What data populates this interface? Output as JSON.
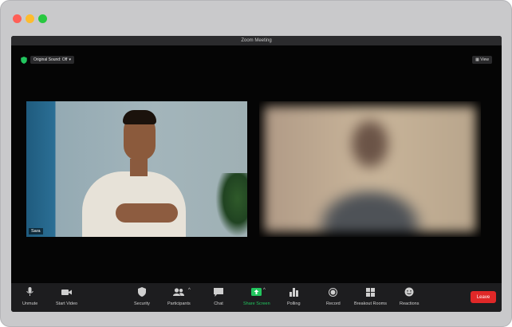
{
  "window": {
    "title": "Zoom Meeting"
  },
  "top_controls": {
    "sound_label": "Original Sound: Off",
    "view_label": "View"
  },
  "participants": [
    {
      "name": "Sara"
    }
  ],
  "toolbar": {
    "unmute": "Unmute",
    "start_video": "Start Video",
    "security": "Security",
    "participants": "Participants",
    "chat": "Chat",
    "share_screen": "Share Screen",
    "polling": "Polling",
    "record": "Record",
    "breakout_rooms": "Breakout Rooms",
    "reactions": "Reactions",
    "leave": "Leave"
  },
  "colors": {
    "accent_green": "#22c55e",
    "leave_red": "#e02828"
  }
}
